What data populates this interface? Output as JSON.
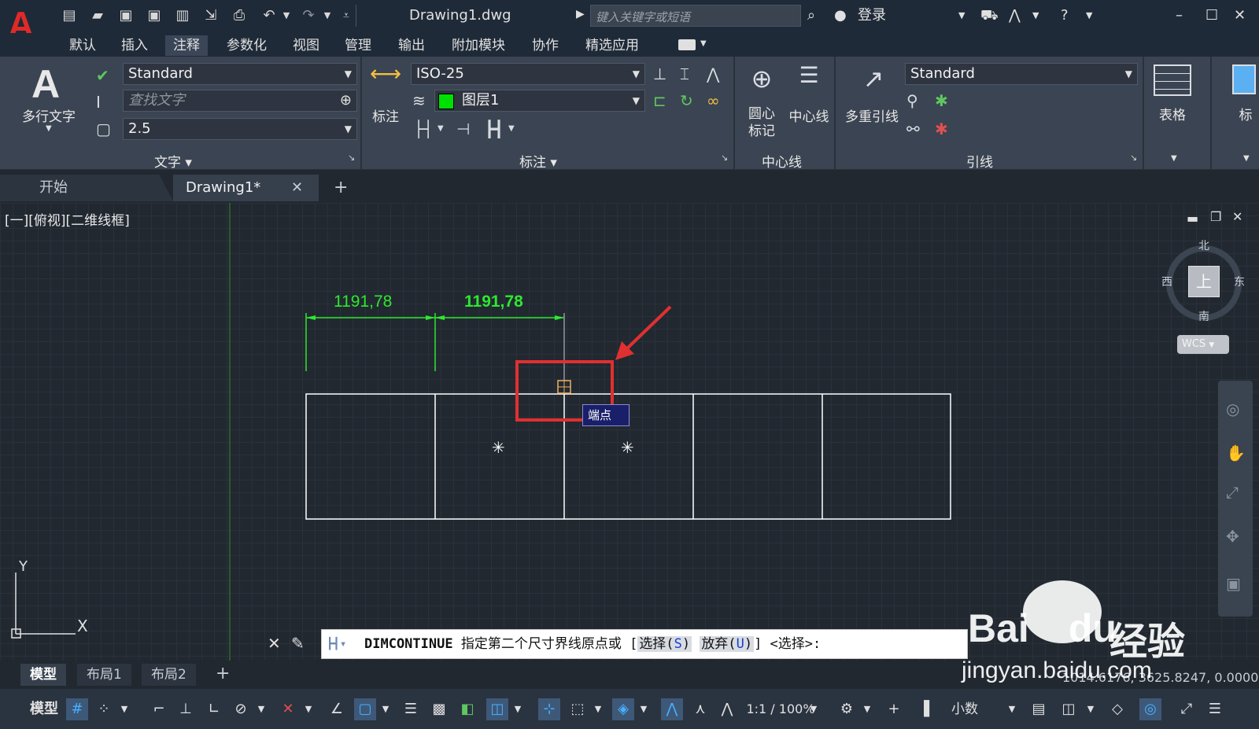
{
  "app": {
    "logo": "A",
    "doc_title": "Drawing1.dwg",
    "search_placeholder": "键入关键字或短语",
    "login": "登录"
  },
  "menu": [
    "默认",
    "插入",
    "注释",
    "参数化",
    "视图",
    "管理",
    "输出",
    "附加模块",
    "协作",
    "精选应用"
  ],
  "menu_active": "注释",
  "ribbon": {
    "text_panel": {
      "title": "文字",
      "multiline_label": "多行文字",
      "style_value": "Standard",
      "find_placeholder": "查找文字",
      "height_value": "2.5"
    },
    "dim_panel": {
      "title": "标注",
      "dim_label": "标注",
      "dimstyle_value": "ISO-25",
      "layer_value": "图层1",
      "layer_color": "#00e000"
    },
    "centerline_panel": {
      "title": "中心线",
      "center_mark_label": "圆心\n标记",
      "centerline_label": "中心线"
    },
    "leader_panel": {
      "title": "引线",
      "multileader_label": "多重引线",
      "leader_style_value": "Standard"
    },
    "table_panel": {
      "table_label": "表格",
      "mark_label": "标"
    }
  },
  "doc_tabs": {
    "start": "开始",
    "drawing": "Drawing1*"
  },
  "viewport": {
    "view_label": "[一][俯视][二维线框]",
    "compass": {
      "north": "北",
      "south": "南",
      "east": "东",
      "west": "西",
      "top": "上"
    },
    "wcs": "WCS",
    "tooltip": "端点",
    "dims": [
      "1191,78",
      "1191,78"
    ],
    "ucs": {
      "x": "X",
      "y": "Y"
    }
  },
  "command": {
    "name": "DIMCONTINUE",
    "prompt": " 指定第二个尺寸界线原点或 [",
    "opt1_label": "选择(",
    "opt1_key": "S",
    "opt2_label": "放弃(",
    "opt2_key": "U",
    "suffix": "] <选择>:"
  },
  "layout_tabs": [
    "模型",
    "布局1",
    "布局2"
  ],
  "status": {
    "coords": "1014.6176, 3625.8247, 0.0000",
    "model": "模型",
    "scale": "1:1 / 100%",
    "units": "小数"
  },
  "watermark": {
    "brand": "Bai",
    "brand2": "du",
    "suffix": "经验",
    "url": "jingyan.baidu.com"
  },
  "colors": {
    "dimension": "#2ee82e",
    "geometry": "#ffffff",
    "highlight": "#e03030",
    "snap": "#f0b060"
  }
}
